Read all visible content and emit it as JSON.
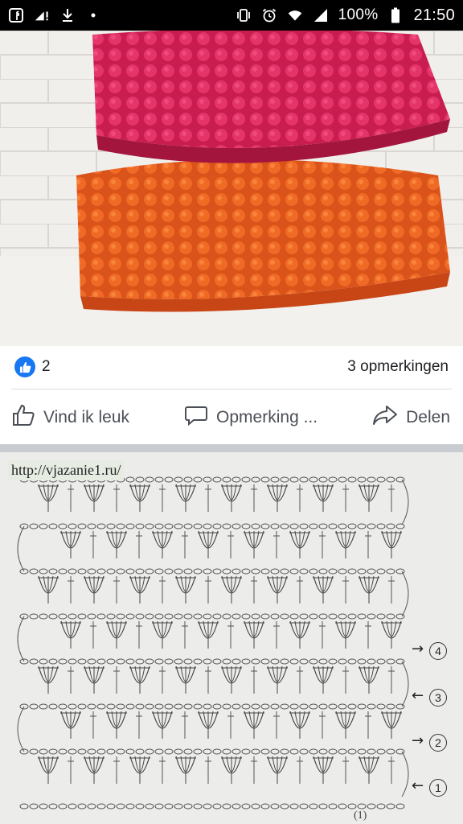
{
  "status_bar": {
    "battery": "100%",
    "time": "21:50",
    "icons_left": [
      "facebook-lite-icon",
      "signal-exclaim-icon",
      "download-icon",
      "dot-icon"
    ],
    "icons_right": [
      "vibrate-icon",
      "alarm-icon",
      "wifi-icon",
      "cell-signal-icon",
      "battery-icon"
    ]
  },
  "post": {
    "photo_alt": "crochet-pillows-photo",
    "likes_count": "2",
    "comments_label": "3 opmerkingen",
    "actions": {
      "like": "Vind ik leuk",
      "comment": "Opmerking ...",
      "share": "Delen"
    }
  },
  "pattern_image": {
    "url_text": "http://vjazanie1.ru/",
    "row_numbers": [
      "4",
      "3",
      "2",
      "1"
    ],
    "footer_text": "(1)"
  },
  "colors": {
    "facebook_blue": "#1877f2",
    "pillow_top": "#d8245a",
    "pillow_bottom": "#ec5f1f"
  }
}
